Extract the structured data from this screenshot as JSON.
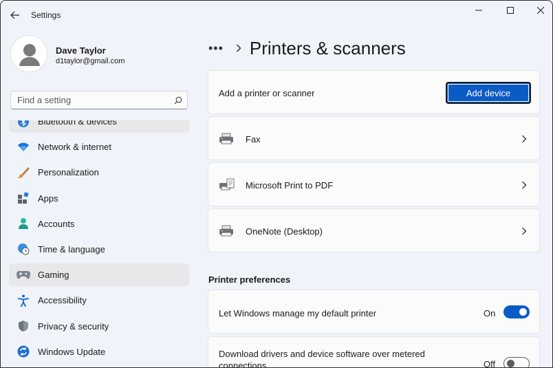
{
  "window": {
    "title": "Settings"
  },
  "profile": {
    "name": "Dave Taylor",
    "email": "d1taylor@gmail.com"
  },
  "search": {
    "placeholder": "Find a setting"
  },
  "sidebar": {
    "items": [
      {
        "label": "Bluetooth & devices",
        "icon": "bluetooth-icon"
      },
      {
        "label": "Network & internet",
        "icon": "wifi-icon"
      },
      {
        "label": "Personalization",
        "icon": "paintbrush-icon"
      },
      {
        "label": "Apps",
        "icon": "apps-icon"
      },
      {
        "label": "Accounts",
        "icon": "person-icon"
      },
      {
        "label": "Time & language",
        "icon": "globe-clock-icon"
      },
      {
        "label": "Gaming",
        "icon": "gamepad-icon"
      },
      {
        "label": "Accessibility",
        "icon": "accessibility-icon"
      },
      {
        "label": "Privacy & security",
        "icon": "shield-icon"
      },
      {
        "label": "Windows Update",
        "icon": "update-icon"
      }
    ],
    "active": "Gaming"
  },
  "header": {
    "more": "•••",
    "title": "Printers & scanners"
  },
  "add_printer": {
    "label": "Add a printer or scanner",
    "button": "Add device"
  },
  "printers": [
    {
      "name": "Fax",
      "icon": "fax-printer-icon"
    },
    {
      "name": "Microsoft Print to PDF",
      "icon": "pdf-printer-icon"
    },
    {
      "name": "OneNote (Desktop)",
      "icon": "printer-icon"
    }
  ],
  "preferences": {
    "title": "Printer preferences",
    "default_printer": {
      "label": "Let Windows manage my default printer",
      "state": "On"
    },
    "metered": {
      "label": "Download drivers and device software over metered connections",
      "state": "Off"
    }
  },
  "colors": {
    "accent": "#0a5bc4",
    "background": "#f0f3f9",
    "card": "#fbfbfb"
  }
}
